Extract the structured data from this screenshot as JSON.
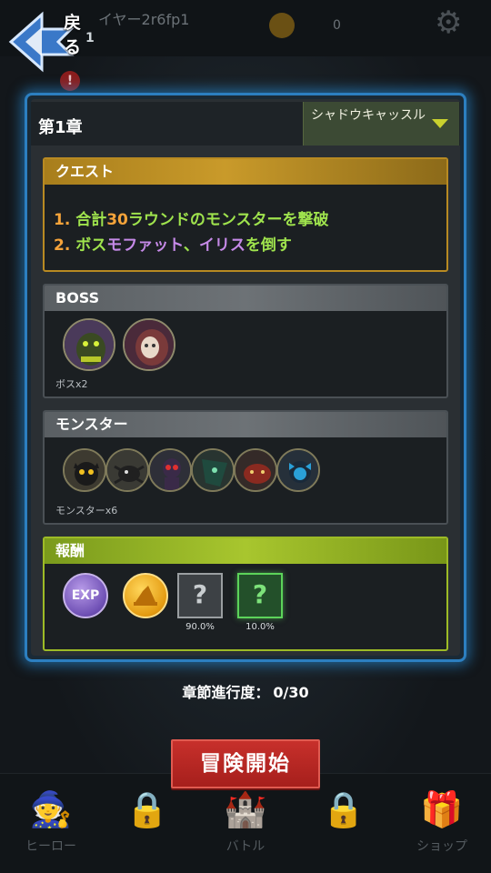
{
  "header": {
    "back_label": "戻る",
    "back_badge": "1",
    "player_name": "イヤー2r6fp1",
    "coin_value": "0"
  },
  "chapter": {
    "title": "第1章",
    "stage_name": "シャドウキャッスル"
  },
  "quest": {
    "heading": "クエスト",
    "line1": {
      "num": "1.",
      "pre": "合計",
      "count": "30",
      "post": "ラウンドのモンスターを撃破"
    },
    "line2": {
      "num": "2.",
      "pre": "ボス",
      "boss1": "モファット",
      "sep": "、",
      "boss2": "イリス",
      "post": "を倒す"
    }
  },
  "boss": {
    "heading": "BOSS",
    "footer": "ボスx2",
    "portraits": [
      "boss-moffat-portrait",
      "boss-iris-portrait"
    ]
  },
  "monsters": {
    "heading": "モンスター",
    "footer": "モンスターx6",
    "portraits": [
      "monster-1",
      "monster-2",
      "monster-3",
      "monster-4",
      "monster-5",
      "monster-6"
    ]
  },
  "reward": {
    "heading": "報酬",
    "items": [
      {
        "name": "exp-icon",
        "label": "EXP"
      },
      {
        "name": "gold-coin-icon",
        "label": ""
      },
      {
        "name": "mystery-box-icon",
        "label": "?",
        "chance": "90.0%"
      },
      {
        "name": "rare-mystery-box-icon",
        "label": "?",
        "chance": "10.0%"
      }
    ]
  },
  "progress": {
    "label": "章節進行度：",
    "value": "0/30"
  },
  "start_button": "冒険開始",
  "nav": {
    "hero": "ヒーロー",
    "battle": "バトル",
    "shop": "ショップ"
  },
  "colors": {
    "accent_blue": "#2c7fc0",
    "quest_gold": "#c99a2a",
    "reward_green": "#a8c62e",
    "start_red": "#b8282a"
  }
}
